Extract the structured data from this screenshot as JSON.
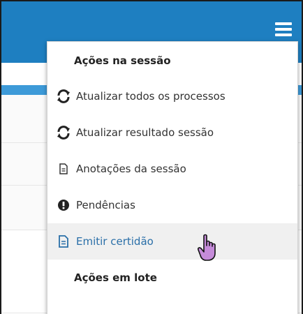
{
  "menu": {
    "header_session": "Ações na sessão",
    "items": [
      {
        "label": "Atualizar todos os processos",
        "icon": "refresh-icon"
      },
      {
        "label": "Atualizar resultado sessão",
        "icon": "refresh-icon"
      },
      {
        "label": "Anotações da sessão",
        "icon": "document-icon"
      },
      {
        "label": "Pendências",
        "icon": "exclamation-circle-icon"
      },
      {
        "label": "Emitir certidão",
        "icon": "document-icon",
        "highlighted": true
      }
    ],
    "header_batch": "Ações em lote"
  },
  "colors": {
    "topbar": "#1e7fc1",
    "highlight_text": "#2a6fa8",
    "highlight_bg": "#f0f0f0",
    "cursor": "#c58bd9"
  }
}
